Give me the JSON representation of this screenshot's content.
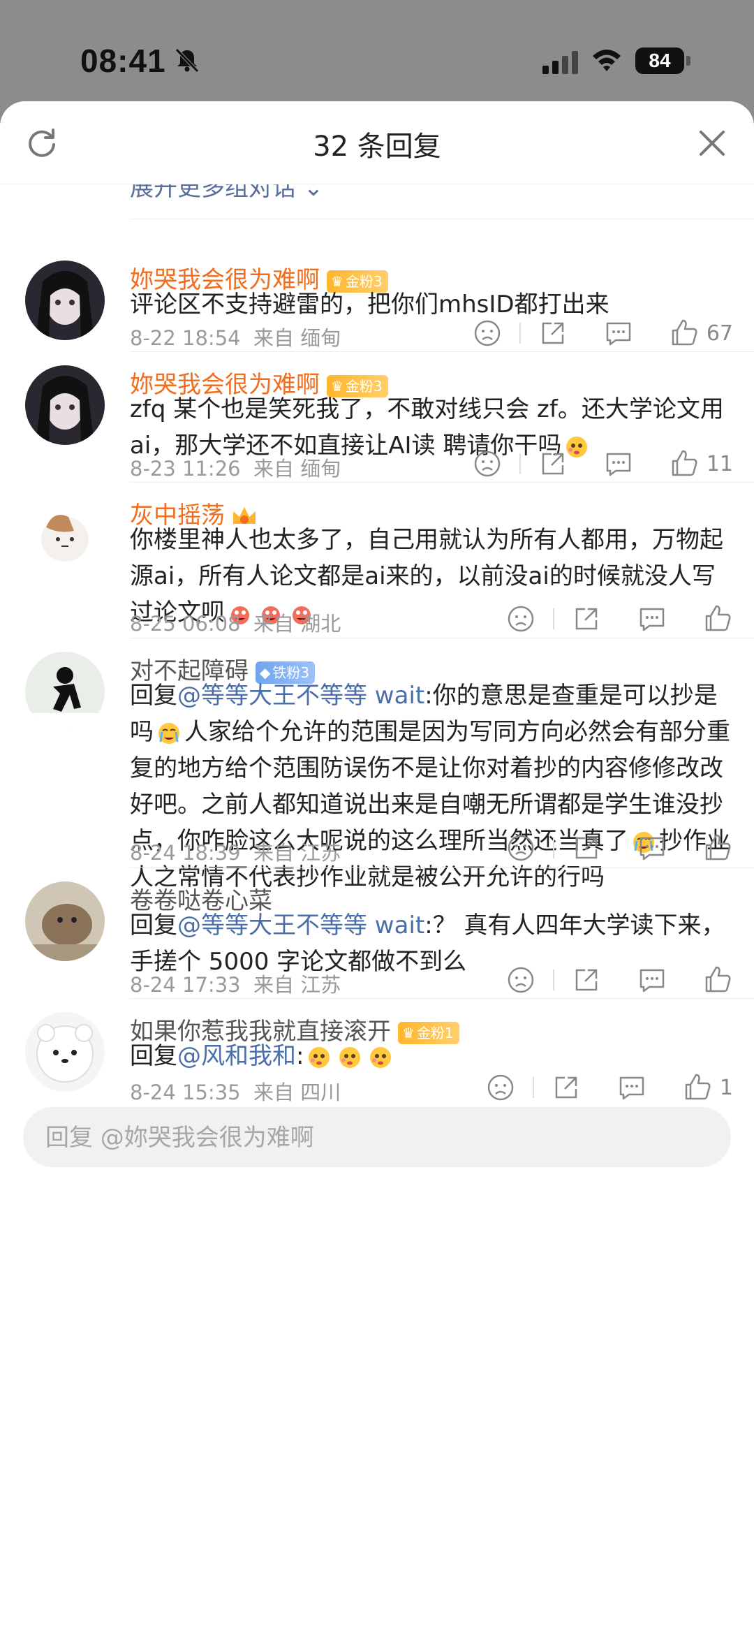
{
  "status": {
    "time": "08:41",
    "battery": "84"
  },
  "header": {
    "title": "32 条回复"
  },
  "expand_label": "展开更多组对话 ⌄",
  "comments": [
    {
      "name": "妳哭我会很为难啊",
      "badge": "金粉3",
      "text": "评论区不支持避雷的，把你们mhsID都打出来",
      "date": "8-22 18:54",
      "from": "来自 缅甸",
      "likes": "67"
    },
    {
      "name": "妳哭我会很为难啊",
      "badge": "金粉3",
      "text": "zfq 某个也是笑死我了，不敢对线只会 zf。还大学论文用ai，那大学还不如直接让AI读 聘请你干吗",
      "date": "8-23 11:26",
      "from": "来自 缅甸",
      "likes": "11"
    },
    {
      "name": "灰中摇荡",
      "text": "你楼里神人也太多了，自己用就认为所有人都用，万物起源ai，所有人论文都是ai来的，以前没ai的时候就没人写过论文呗",
      "date": "8-25 06:08",
      "from": "来自 湖北"
    },
    {
      "name": "对不起障碍",
      "badge": "铁粉3",
      "reply_prefix": "回复",
      "mention": "@等等大王不等等 wait",
      "text_a": ":你的意思是查重是可以抄是吗",
      "text_b": "人家给个允许的范围是因为写同方向必然会有部分重复的地方给个范围防误伤不是让你对着抄的内容修修改改好吧。之前人都知道说出来是自嘲无所谓都是学生谁没抄点，你咋脸这么大呢说的这么理所当然还当真了",
      "text_c": "抄作业人之常情不代表抄作业就是被公开允许的行吗",
      "date": "8-24 18:39",
      "from": "来自 江苏"
    },
    {
      "name": "卷卷哒卷心菜",
      "reply_prefix": "回复",
      "mention": "@等等大王不等等 wait",
      "text": ":？ 真有人四年大学读下来，手搓个 5000 字论文都做不到么",
      "date": "8-24 17:33",
      "from": "来自 江苏"
    },
    {
      "name": "如果你惹我我就直接滚开",
      "badge": "金粉1",
      "reply_prefix": "回复",
      "mention": "@风和我和",
      "text": ":",
      "date": "8-24 15:35",
      "from": "来自 四川",
      "likes": "1"
    }
  ],
  "reply_input": {
    "placeholder": "回复 @妳哭我会很为难啊"
  },
  "colors": {
    "accent_orange": "#f26d1d",
    "mention_blue": "#4a6ea9",
    "gold_badge": "#ffb52e",
    "iron_badge": "#6fa3f2"
  }
}
